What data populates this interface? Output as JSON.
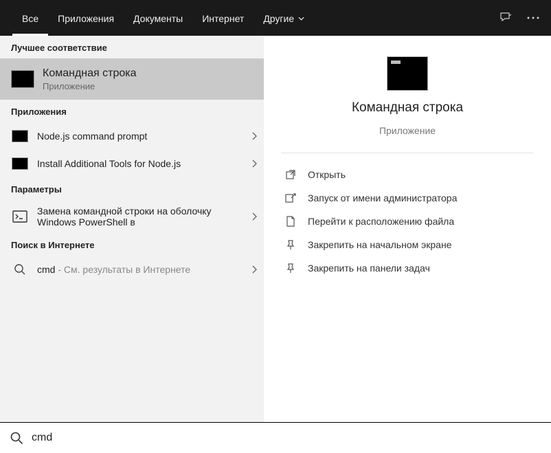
{
  "tabs": {
    "all": "Все",
    "apps": "Приложения",
    "docs": "Документы",
    "web": "Интернет",
    "more": "Другие"
  },
  "sections": {
    "best": "Лучшее соответствие",
    "apps": "Приложения",
    "settings": "Параметры",
    "web": "Поиск в Интернете"
  },
  "best_match": {
    "title": "Командная строка",
    "sub": "Приложение"
  },
  "apps_list": [
    {
      "label": "Node.js command prompt"
    },
    {
      "label": "Install Additional Tools for Node.js"
    }
  ],
  "settings_list": [
    {
      "label": "Замена командной строки на оболочку Windows PowerShell в"
    }
  ],
  "web_list": {
    "query": "cmd",
    "hint": " - См. результаты в Интернете"
  },
  "preview": {
    "title": "Командная строка",
    "sub": "Приложение"
  },
  "actions": {
    "open": "Открыть",
    "admin": "Запуск от имени администратора",
    "location": "Перейти к расположению файла",
    "pin_start": "Закрепить на начальном экране",
    "pin_task": "Закрепить на панели задач"
  },
  "search": {
    "value": "cmd"
  }
}
